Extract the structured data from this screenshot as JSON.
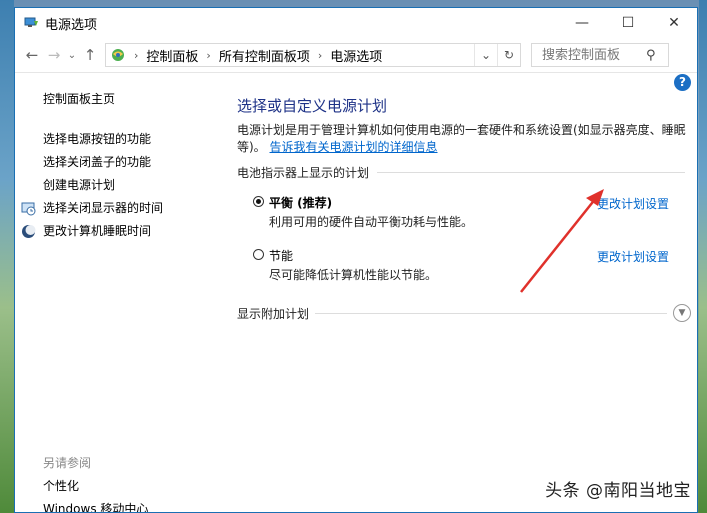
{
  "window": {
    "title": "电源选项"
  },
  "controls": {
    "minimize": "—",
    "maximize": "☐",
    "close": "✕"
  },
  "address": {
    "crumbs": [
      "控制面板",
      "所有控制面板项",
      "电源选项"
    ],
    "search_placeholder": "搜索控制面板"
  },
  "sidebar": {
    "home": "控制面板主页",
    "items": [
      {
        "label": "选择电源按钮的功能",
        "icon": ""
      },
      {
        "label": "选择关闭盖子的功能",
        "icon": ""
      },
      {
        "label": "创建电源计划",
        "icon": ""
      },
      {
        "label": "选择关闭显示器的时间",
        "icon": "monitor-clock-icon"
      },
      {
        "label": "更改计算机睡眠时间",
        "icon": "moon-icon"
      }
    ],
    "see_also": "另请参阅",
    "links": [
      "个性化",
      "Windows 移动中心"
    ]
  },
  "main": {
    "title": "选择或自定义电源计划",
    "desc_text": "电源计划是用于管理计算机如何使用电源的一套硬件和系统设置(如显示器亮度、睡眠等)。",
    "desc_link": "告诉我有关电源计划的详细信息",
    "group_header": "电池指示器上显示的计划",
    "plans": [
      {
        "name": "平衡 (推荐)",
        "desc": "利用可用的硬件自动平衡功耗与性能。",
        "link": "更改计划设置",
        "selected": true
      },
      {
        "name": "节能",
        "desc": "尽可能降低计算机性能以节能。",
        "link": "更改计划设置",
        "selected": false
      }
    ],
    "more_plans": "显示附加计划"
  },
  "annotation": {
    "color": "#e0312b"
  },
  "watermark": "头条 @南阳当地宝"
}
